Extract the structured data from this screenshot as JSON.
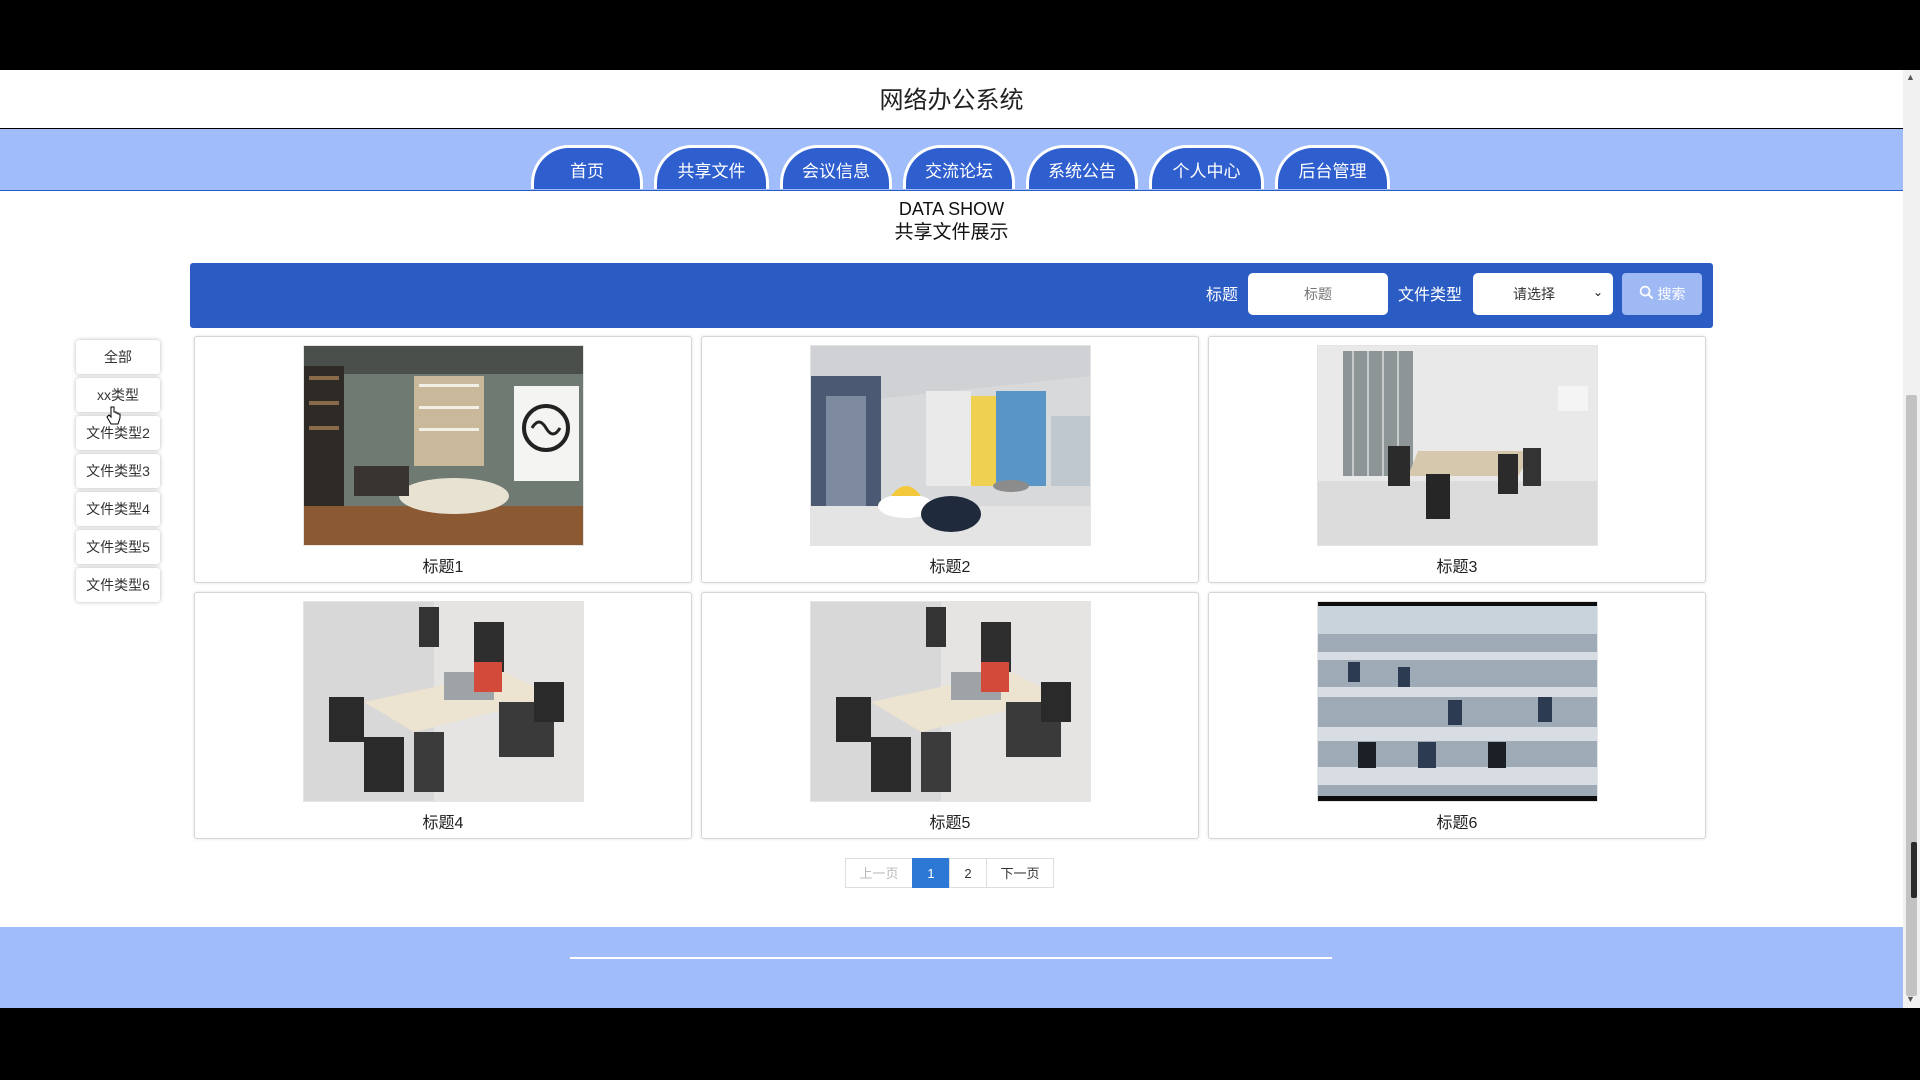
{
  "site": {
    "title": "网络办公系统"
  },
  "nav": {
    "items": [
      "首页",
      "共享文件",
      "会议信息",
      "交流论坛",
      "系统公告",
      "个人中心",
      "后台管理"
    ]
  },
  "headline": {
    "en": "DATA SHOW",
    "zh": "共享文件展示"
  },
  "search": {
    "title_label": "标题",
    "title_placeholder": "标题",
    "type_label": "文件类型",
    "type_selected": "请选择",
    "button_label": "搜索"
  },
  "sidebar": {
    "items": [
      "全部",
      "xx类型",
      "文件类型2",
      "文件类型3",
      "文件类型4",
      "文件类型5",
      "文件类型6"
    ]
  },
  "cards": [
    {
      "title": "标题1",
      "image": "office-room-brain-art"
    },
    {
      "title": "标题2",
      "image": "modern-office-lounge"
    },
    {
      "title": "标题3",
      "image": "meeting-room"
    },
    {
      "title": "标题4",
      "image": "office-desks"
    },
    {
      "title": "标题5",
      "image": "office-desks"
    },
    {
      "title": "标题6",
      "image": "large-open-office"
    }
  ],
  "pagination": {
    "prev": "上一页",
    "pages": [
      "1",
      "2"
    ],
    "current": "1",
    "next": "下一页"
  },
  "colors": {
    "nav_bg": "#a1bcfa",
    "nav_tab": "#2f5fcf",
    "search_bar": "#2b5cc4",
    "active_page": "#2c78d4"
  }
}
